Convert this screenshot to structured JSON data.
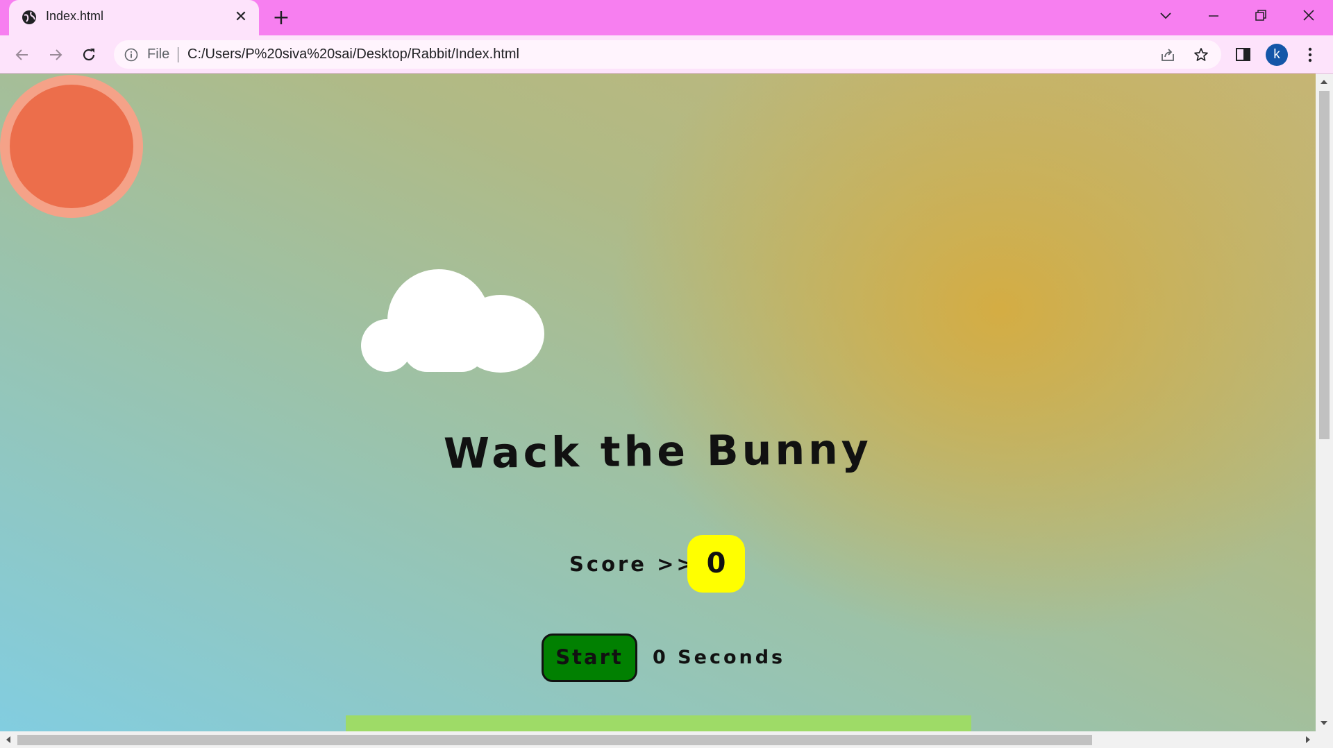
{
  "browser": {
    "tab_title": "Index.html",
    "scheme_label": "File",
    "url": "C:/Users/P%20siva%20sai/Desktop/Rabbit/Index.html",
    "profile_initial": "k"
  },
  "game": {
    "title": "Wack the Bunny",
    "score_label": "Score >>",
    "score_value": "0",
    "start_label": "Start",
    "timer_text": "0 Seconds"
  },
  "colors": {
    "chrome_accent": "#f77ff0",
    "sun": "#ec6e4b",
    "score_box": "#ffff00",
    "start_button": "#018001",
    "ground": "#9edb67"
  },
  "icons": [
    "globe-icon",
    "close-icon",
    "plus-icon",
    "chevron-down-icon",
    "minimize-icon",
    "restore-icon",
    "window-close-icon",
    "back-icon",
    "forward-icon",
    "reload-icon",
    "info-icon",
    "share-icon",
    "star-icon",
    "side-panel-icon",
    "more-icon"
  ]
}
